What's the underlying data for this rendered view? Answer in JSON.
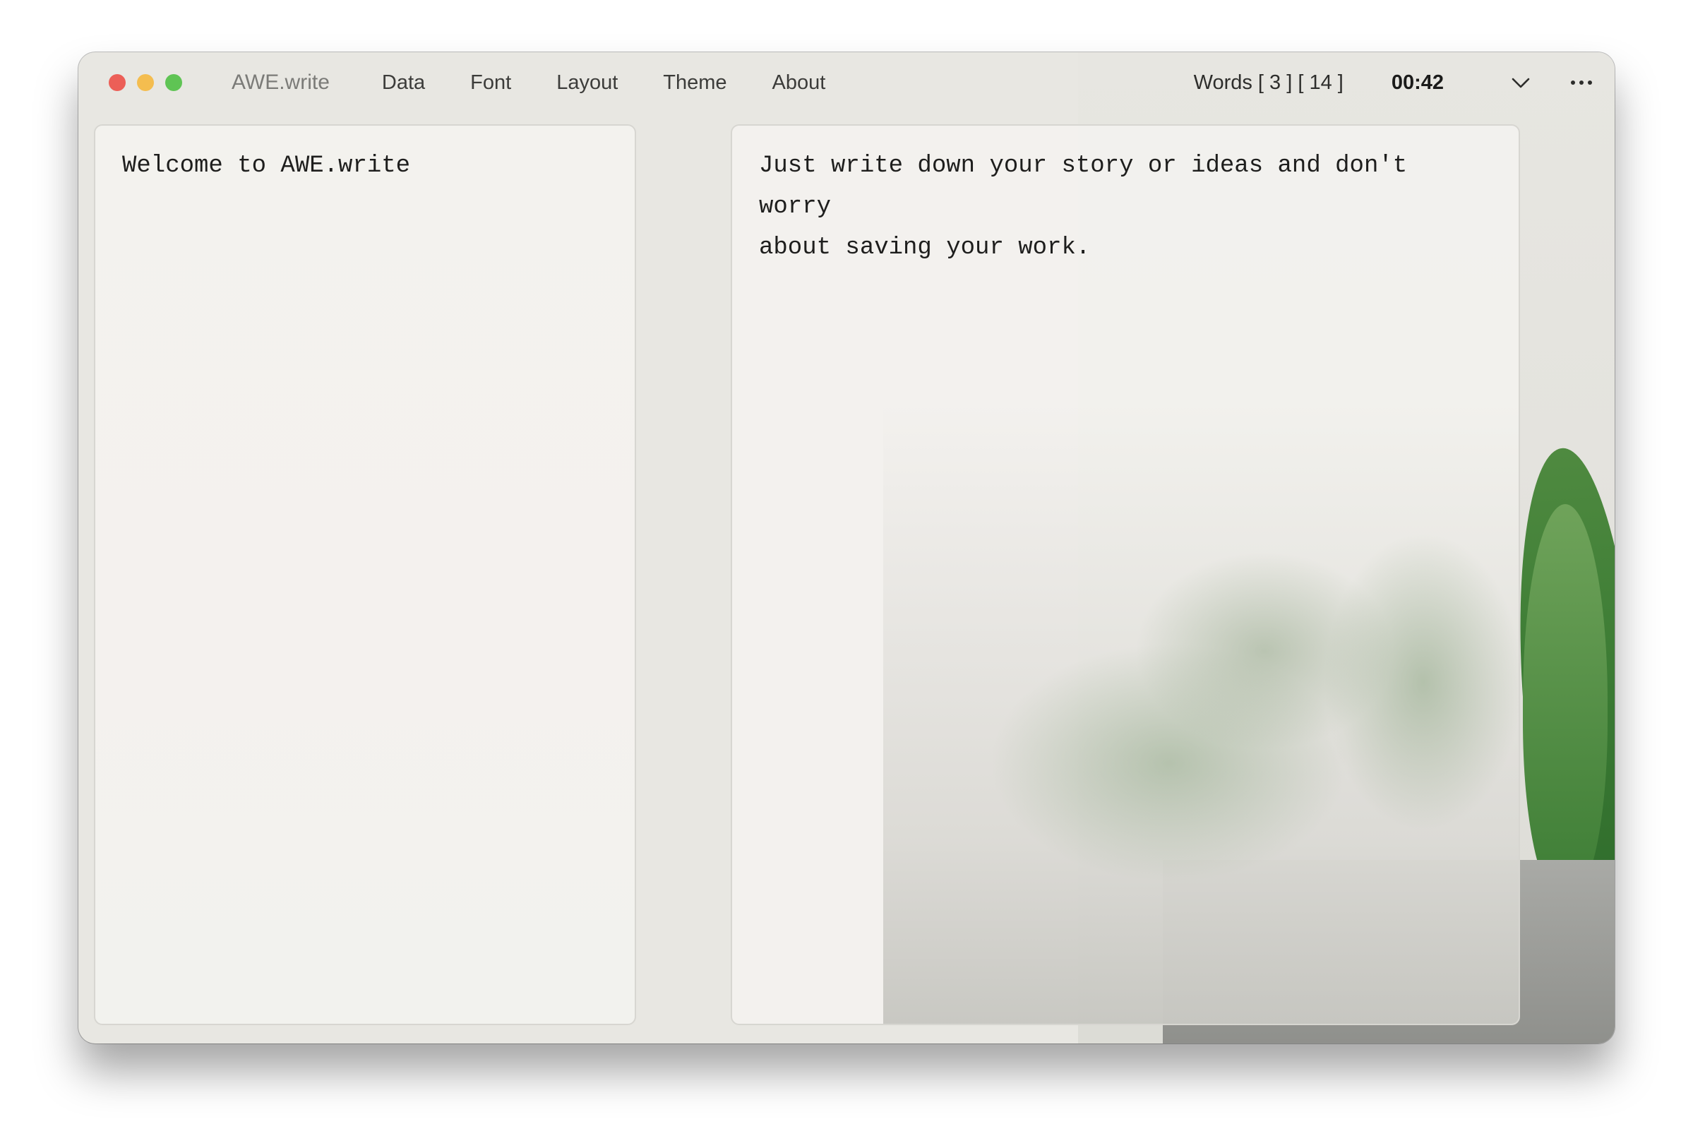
{
  "window": {
    "app_title": "AWE.write"
  },
  "traffic_lights": {
    "close_color": "#ec5f57",
    "minimize_color": "#f4bd4f",
    "maximize_color": "#5fc454"
  },
  "menu": {
    "items": [
      {
        "label": "Data"
      },
      {
        "label": "Font"
      },
      {
        "label": "Layout"
      },
      {
        "label": "Theme"
      },
      {
        "label": "About"
      }
    ]
  },
  "status": {
    "words": "Words [ 3 ] [ 14 ]",
    "timer": "00:42"
  },
  "icons": {
    "dropdown": "chevron-down-icon",
    "more": "more-icon"
  },
  "editor": {
    "left_text": "Welcome to AWE.write",
    "right_text": "Just write down your story or ideas and don't worry\nabout saving your work."
  }
}
